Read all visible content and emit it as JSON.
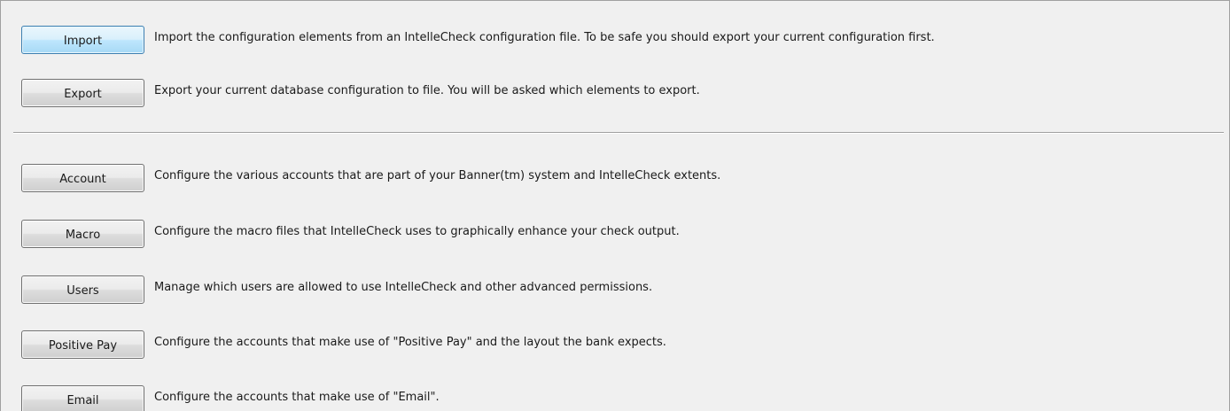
{
  "import_section": [
    {
      "button": "Import",
      "description": "Import the configuration elements from an IntelleCheck configuration file.  To be safe you should export your current configuration first."
    },
    {
      "button": "Export",
      "description": "Export your current database configuration to file.  You will be asked which elements to export."
    }
  ],
  "config_section": [
    {
      "button": "Account",
      "description": "Configure the various accounts that are part of your Banner(tm) system and IntelleCheck extents."
    },
    {
      "button": "Macro",
      "description": "Configure the macro files that IntelleCheck uses to graphically enhance your check output."
    },
    {
      "button": "Users",
      "description": "Manage which users are allowed to use IntelleCheck and other advanced permissions."
    },
    {
      "button": "Positive Pay",
      "description": "Configure the accounts that make use of \"Positive Pay\" and the layout the bank expects."
    },
    {
      "button": "Email",
      "description": "Configure the accounts that make use of \"Email\"."
    }
  ]
}
